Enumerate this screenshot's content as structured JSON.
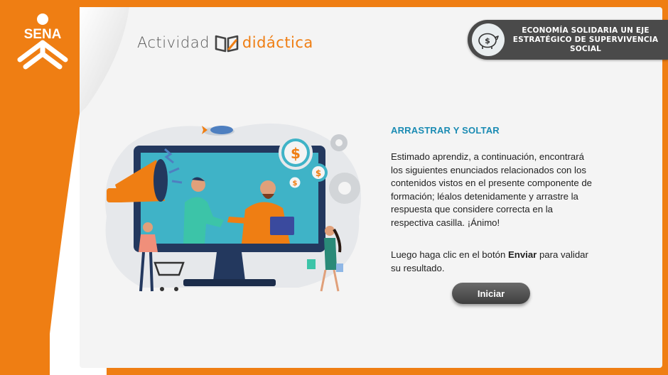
{
  "activity": {
    "word1": "Actividad",
    "word2": "didáctica"
  },
  "logo": {
    "text": "SENA"
  },
  "topic_badge": {
    "text": "ECONOMÍA SOLIDARIA UN EJE ESTRATÉGICO DE SUPERVIVENCIA SOCIAL",
    "icon": "piggy-bank-dollar-icon"
  },
  "content": {
    "title": "ARRASTRAR Y SOLTAR",
    "paragraph1": "Estimado aprendiz, a continuación, encontrará los siguientes enunciados relacionados con los contenidos vistos en el presente componente de formación; léalos detenidamente y arrastre la respuesta que considere correcta en la respectiva casilla. ¡Ánimo!",
    "paragraph2_before": "Luego haga clic en el botón ",
    "paragraph2_bold": "Enviar",
    "paragraph2_after": " para validar su resultado.",
    "start_button": "Iniciar"
  },
  "illustration": {
    "description_icons": [
      "monitor-icon",
      "megaphone-icon",
      "dollar-coin-icon",
      "gear-icon",
      "rocket-icon",
      "shopping-cart-icon",
      "handshake-icon"
    ],
    "coin_symbol": "$"
  },
  "colors": {
    "brand_orange": "#ef7e13",
    "title_blue": "#1a8bb3",
    "badge_gray": "#4a4a4a",
    "card_bg": "#f4f4f4",
    "screen_teal": "#3fb3c7"
  }
}
